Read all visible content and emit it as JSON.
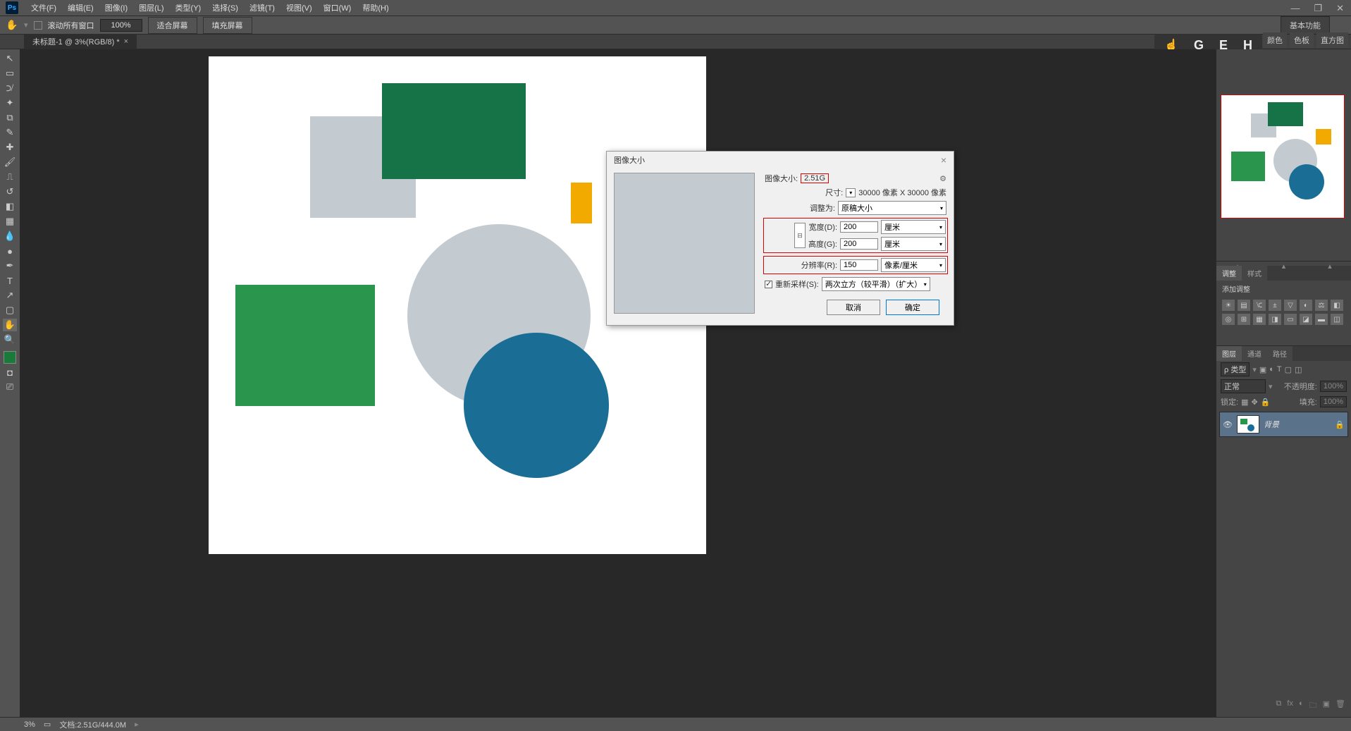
{
  "menu": {
    "items": [
      "文件(F)",
      "编辑(E)",
      "图像(I)",
      "图层(L)",
      "类型(Y)",
      "选择(S)",
      "滤镜(T)",
      "视图(V)",
      "窗口(W)",
      "帮助(H)"
    ]
  },
  "options": {
    "scroll_all": "滚动所有窗口",
    "zoom_value": "100%",
    "fit_screen": "适合屏幕",
    "fill_screen": "填充屏幕",
    "essentials": "基本功能"
  },
  "tab": {
    "title": "未标题-1 @ 3%(RGB/8) *"
  },
  "dialog": {
    "title": "图像大小",
    "image_size_label": "图像大小:",
    "image_size_value": "2.51G",
    "dimensions_label": "尺寸:",
    "dimensions_value": "30000 像素 X 30000 像素",
    "fit_to_label": "调整为:",
    "fit_to_value": "原稿大小",
    "width_label": "宽度(D):",
    "width_value": "200",
    "width_unit": "厘米",
    "height_label": "高度(G):",
    "height_value": "200",
    "height_unit": "厘米",
    "resolution_label": "分辨率(R):",
    "resolution_value": "150",
    "resolution_unit": "像素/厘米",
    "resample_label": "重新采样(S):",
    "resample_value": "两次立方（较平滑）（扩大）",
    "ok": "确定",
    "cancel": "取消"
  },
  "panels": {
    "color": "颜色",
    "swatches": "色板",
    "histogram": "直方图",
    "adjustments_tab": "调整",
    "styles_tab": "样式",
    "add_adjustment": "添加调整",
    "layers_tab": "图层",
    "channels_tab": "通道",
    "paths_tab": "路径",
    "kind_label": "ρ 类型",
    "blend_mode": "正常",
    "opacity_label": "不透明度:",
    "opacity_value": "100%",
    "lock_label": "锁定:",
    "fill_label": "填充:",
    "fill_value": "100%",
    "layer_name": "背景"
  },
  "status": {
    "zoom": "3%",
    "doc_info": "文档:2.51G/444.0M"
  },
  "tutorial": {
    "letters": [
      "G",
      "E",
      "H"
    ]
  }
}
